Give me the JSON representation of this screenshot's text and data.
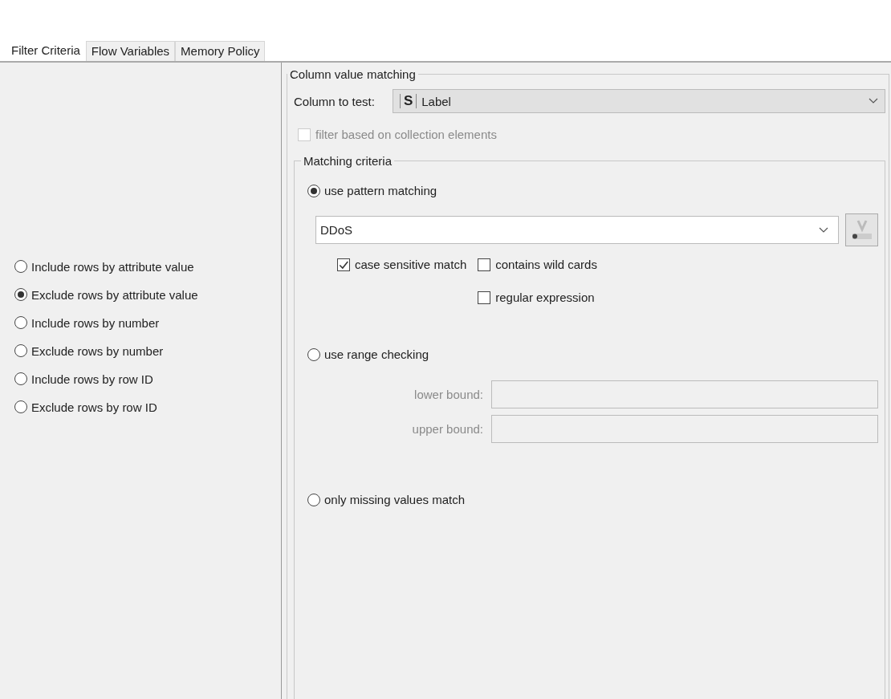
{
  "tabs": [
    {
      "label": "Filter Criteria",
      "selected": true
    },
    {
      "label": "Flow Variables",
      "selected": false
    },
    {
      "label": "Memory Policy",
      "selected": false
    }
  ],
  "filter_modes": [
    {
      "label": "Include rows by attribute value",
      "selected": false
    },
    {
      "label": "Exclude rows by attribute value",
      "selected": true
    },
    {
      "label": "Include rows by number",
      "selected": false
    },
    {
      "label": "Exclude rows by number",
      "selected": false
    },
    {
      "label": "Include rows by row ID",
      "selected": false
    },
    {
      "label": "Exclude rows by row ID",
      "selected": false
    }
  ],
  "column_value_matching": {
    "title": "Column value matching",
    "column_to_test": {
      "label": "Column to test:",
      "type_badge": "S",
      "value": "Label"
    },
    "collection_filter": {
      "label": "filter based on collection elements",
      "checked": false,
      "disabled": true
    },
    "matching_criteria": {
      "title": "Matching criteria",
      "pattern_matching": {
        "label": "use pattern matching",
        "selected": true,
        "pattern": "DDoS",
        "options": [
          {
            "label": "case sensitive match",
            "checked": true
          },
          {
            "label": "contains wild cards",
            "checked": false
          },
          {
            "label": "regular expression",
            "checked": false
          }
        ]
      },
      "range_checking": {
        "label": "use range checking",
        "selected": false,
        "disabled": true,
        "lower_bound": {
          "label": "lower bound:"
        },
        "upper_bound": {
          "label": "upper bound:"
        }
      },
      "missing_values": {
        "label": "only missing values match",
        "selected": false
      }
    }
  }
}
